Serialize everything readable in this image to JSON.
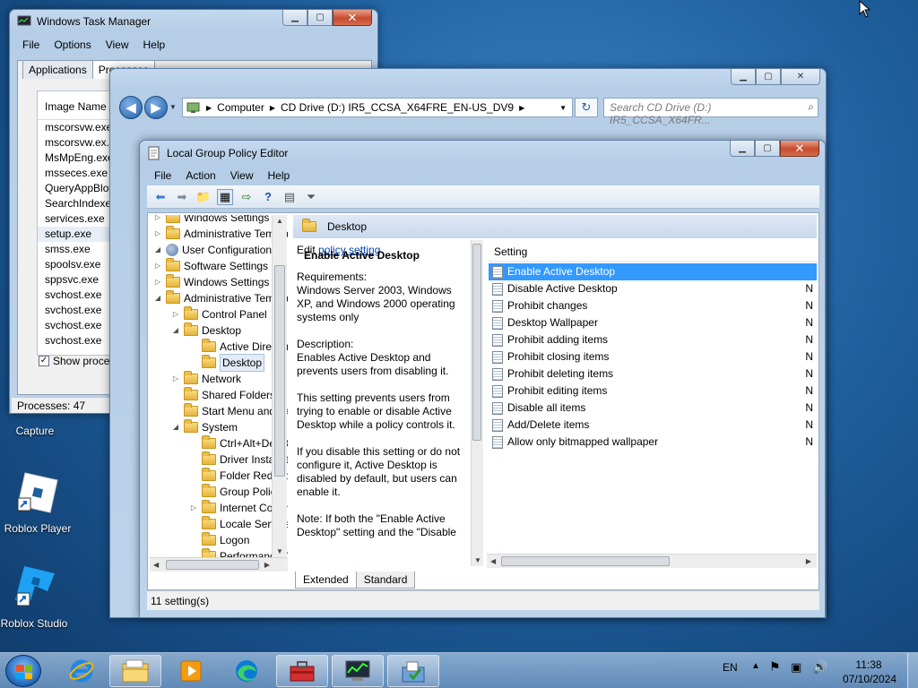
{
  "desktop": {
    "icons": [
      {
        "label": "Capture"
      },
      {
        "label": "Roblox Player"
      },
      {
        "label": "Roblox Studio"
      }
    ]
  },
  "taskmgr": {
    "title": "Windows Task Manager",
    "menu": [
      "File",
      "Options",
      "View",
      "Help"
    ],
    "tabs": [
      "Applications",
      "Processes"
    ],
    "column": "Image Name",
    "processes": [
      "mscorsvw.exe",
      "mscorsvw.ex...",
      "MsMpEng.exe",
      "msseces.exe",
      "QueryAppBloc...",
      "SearchIndexe...",
      "services.exe",
      "setup.exe",
      "smss.exe",
      "spoolsv.exe",
      "sppsvc.exe",
      "svchost.exe",
      "svchost.exe",
      "svchost.exe",
      "svchost.exe"
    ],
    "show_process": "Show process",
    "status": "Processes: 47"
  },
  "explorer": {
    "address": [
      "Computer",
      "CD Drive (D:) IR5_CCSA_X64FRE_EN-US_DV9"
    ],
    "search_placeholder": "Search CD Drive (D:) IR5_CCSA_X64FR..."
  },
  "gpedit": {
    "title": "Local Group Policy Editor",
    "menu": [
      "File",
      "Action",
      "View",
      "Help"
    ],
    "tree": [
      {
        "label": "Windows Settings",
        "indent": 0,
        "tw": "▷",
        "icon": "folder"
      },
      {
        "label": "Administrative Templates",
        "indent": 0,
        "tw": "▷",
        "icon": "folder"
      },
      {
        "label": "User Configuration",
        "indent": -1,
        "tw": "◢",
        "icon": "user"
      },
      {
        "label": "Software Settings",
        "indent": 0,
        "tw": "▷",
        "icon": "folder"
      },
      {
        "label": "Windows Settings",
        "indent": 0,
        "tw": "▷",
        "icon": "folder"
      },
      {
        "label": "Administrative Templates",
        "indent": 0,
        "tw": "◢",
        "icon": "folder"
      },
      {
        "label": "Control Panel",
        "indent": 1,
        "tw": "▷",
        "icon": "folder"
      },
      {
        "label": "Desktop",
        "indent": 1,
        "tw": "◢",
        "icon": "folder"
      },
      {
        "label": "Active Directory",
        "indent": 2,
        "tw": "",
        "icon": "folder"
      },
      {
        "label": "Desktop",
        "indent": 2,
        "tw": "",
        "icon": "folder",
        "selected": true
      },
      {
        "label": "Network",
        "indent": 1,
        "tw": "▷",
        "icon": "folder"
      },
      {
        "label": "Shared Folders",
        "indent": 1,
        "tw": "",
        "icon": "folder"
      },
      {
        "label": "Start Menu and Taskbar",
        "indent": 1,
        "tw": "",
        "icon": "folder"
      },
      {
        "label": "System",
        "indent": 1,
        "tw": "◢",
        "icon": "folder"
      },
      {
        "label": "Ctrl+Alt+Del Options",
        "indent": 2,
        "tw": "",
        "icon": "folder"
      },
      {
        "label": "Driver Installation",
        "indent": 2,
        "tw": "",
        "icon": "folder"
      },
      {
        "label": "Folder Redirection",
        "indent": 2,
        "tw": "",
        "icon": "folder"
      },
      {
        "label": "Group Policy",
        "indent": 2,
        "tw": "",
        "icon": "folder"
      },
      {
        "label": "Internet Communication",
        "indent": 2,
        "tw": "▷",
        "icon": "folder"
      },
      {
        "label": "Locale Services",
        "indent": 2,
        "tw": "",
        "icon": "folder"
      },
      {
        "label": "Logon",
        "indent": 2,
        "tw": "",
        "icon": "folder"
      },
      {
        "label": "Performance Control",
        "indent": 2,
        "tw": "",
        "icon": "folder"
      }
    ],
    "pane_title": "Desktop",
    "desc_title": "Enable Active Desktop",
    "desc_edit_prefix": "Edit ",
    "desc_edit_link": "policy setting",
    "desc_requirements": "Requirements:\nWindows Server 2003, Windows XP, and Windows 2000 operating systems only",
    "desc_description": "Description:\nEnables Active Desktop and prevents users from disabling it.",
    "desc_p2": "This setting prevents users from trying to enable or disable Active Desktop while a policy controls it.",
    "desc_p3": "If you disable this setting or do not configure it, Active Desktop is disabled by default, but users can enable it.",
    "desc_p4": "Note: If both the \"Enable Active Desktop\" setting and the \"Disable",
    "column_setting": "Setting",
    "settings": [
      {
        "name": "Enable Active Desktop",
        "state": "N"
      },
      {
        "name": "Disable Active Desktop",
        "state": "N"
      },
      {
        "name": "Prohibit changes",
        "state": "N"
      },
      {
        "name": "Desktop Wallpaper",
        "state": "N"
      },
      {
        "name": "Prohibit adding items",
        "state": "N"
      },
      {
        "name": "Prohibit closing items",
        "state": "N"
      },
      {
        "name": "Prohibit deleting items",
        "state": "N"
      },
      {
        "name": "Prohibit editing items",
        "state": "N"
      },
      {
        "name": "Disable all items",
        "state": "N"
      },
      {
        "name": "Add/Delete items",
        "state": "N"
      },
      {
        "name": "Allow only bitmapped wallpaper",
        "state": "N"
      }
    ],
    "tab_extended": "Extended",
    "tab_standard": "Standard",
    "status": "11 setting(s)"
  },
  "tray": {
    "lang": "EN",
    "time": "11:38",
    "date": "07/10/2024"
  },
  "colors": {
    "selection": "#3399ff",
    "link": "#0645ad"
  }
}
